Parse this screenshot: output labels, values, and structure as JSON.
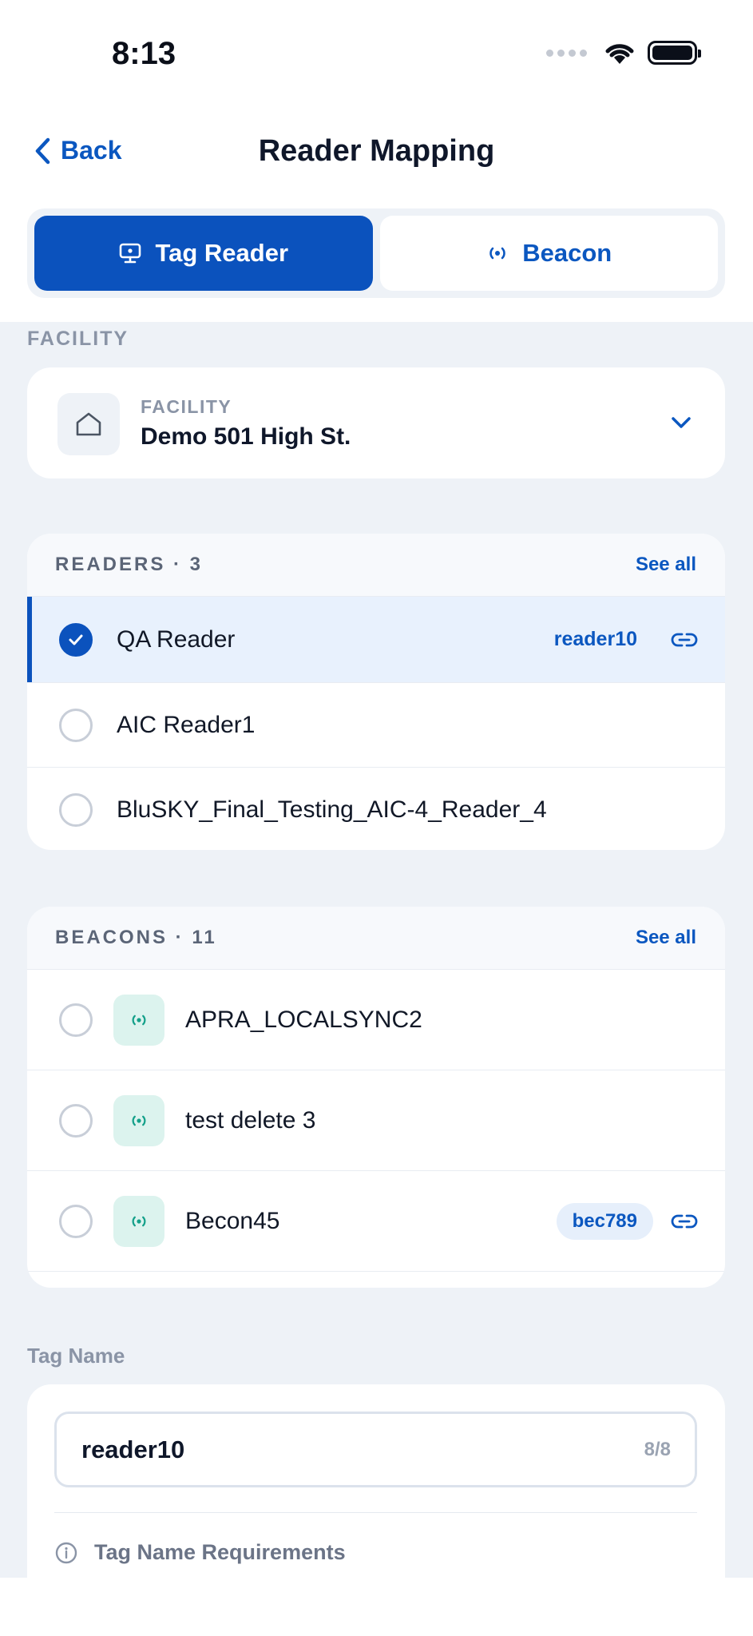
{
  "status": {
    "time": "8:13"
  },
  "nav": {
    "back_label": "Back",
    "title": "Reader Mapping"
  },
  "segment": {
    "tag_reader": "Tag Reader",
    "beacon": "Beacon"
  },
  "facility": {
    "section_label": "FACILITY",
    "field_label": "FACILITY",
    "value": "Demo 501 High St."
  },
  "readers": {
    "header": "READERS · 3",
    "see_all": "See all",
    "items": [
      {
        "name": "QA Reader",
        "tag": "reader10",
        "selected": true
      },
      {
        "name": "AIC Reader1"
      },
      {
        "name": "BluSKY_Final_Testing_AIC-4_Reader_4"
      }
    ]
  },
  "beacons": {
    "header": "BEACONS · 11",
    "see_all": "See all",
    "items": [
      {
        "name": "APRA_LOCALSYNC2"
      },
      {
        "name": "test delete 3"
      },
      {
        "name": "Becon45",
        "tag": "bec789"
      }
    ]
  },
  "tag_name": {
    "label": "Tag Name",
    "value": "reader10",
    "count": "8/8",
    "requirements": "Tag Name Requirements"
  },
  "colors": {
    "primary": "#0b52bd",
    "accent_text": "#0b57c0",
    "beacon_bg": "#dcf3ee",
    "beacon_icon": "#14a08a"
  }
}
